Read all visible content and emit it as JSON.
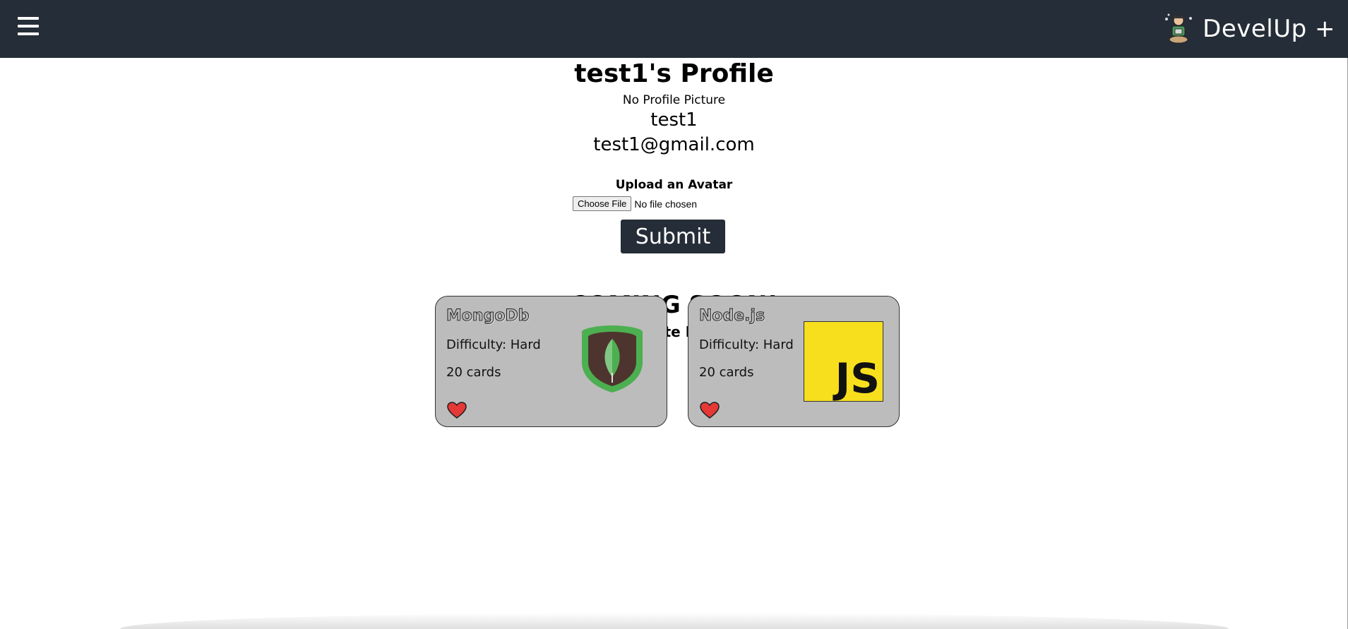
{
  "header": {
    "menu_icon": "hamburger-icon",
    "logo_icon": "developer-mascot-icon",
    "brand": "DevelUp +"
  },
  "profile": {
    "title": "test1's Profile",
    "no_picture": "No Profile Picture",
    "username": "test1",
    "email": "test1@gmail.com"
  },
  "upload": {
    "label": "Upload an Avatar",
    "choose_file": "Choose File",
    "file_status": "No file chosen",
    "submit": "Submit"
  },
  "favorites": {
    "coming_soon": "COMING SOON!",
    "label": "Favorite Decks",
    "decks": [
      {
        "name": "MongoDb",
        "difficulty": "Difficulty: Hard",
        "count": "20 cards",
        "logo_icon": "mongodb-leaf-icon"
      },
      {
        "name": "Node.js",
        "difficulty": "Difficulty: Hard",
        "count": "20 cards",
        "logo_icon": "javascript-icon",
        "logo_text": "JS"
      }
    ]
  },
  "colors": {
    "navbar": "#252d38",
    "card": "#bcbcbc",
    "heart": "#e53935",
    "js_yellow": "#f7df1e",
    "mongo_green": "#4caf50"
  }
}
